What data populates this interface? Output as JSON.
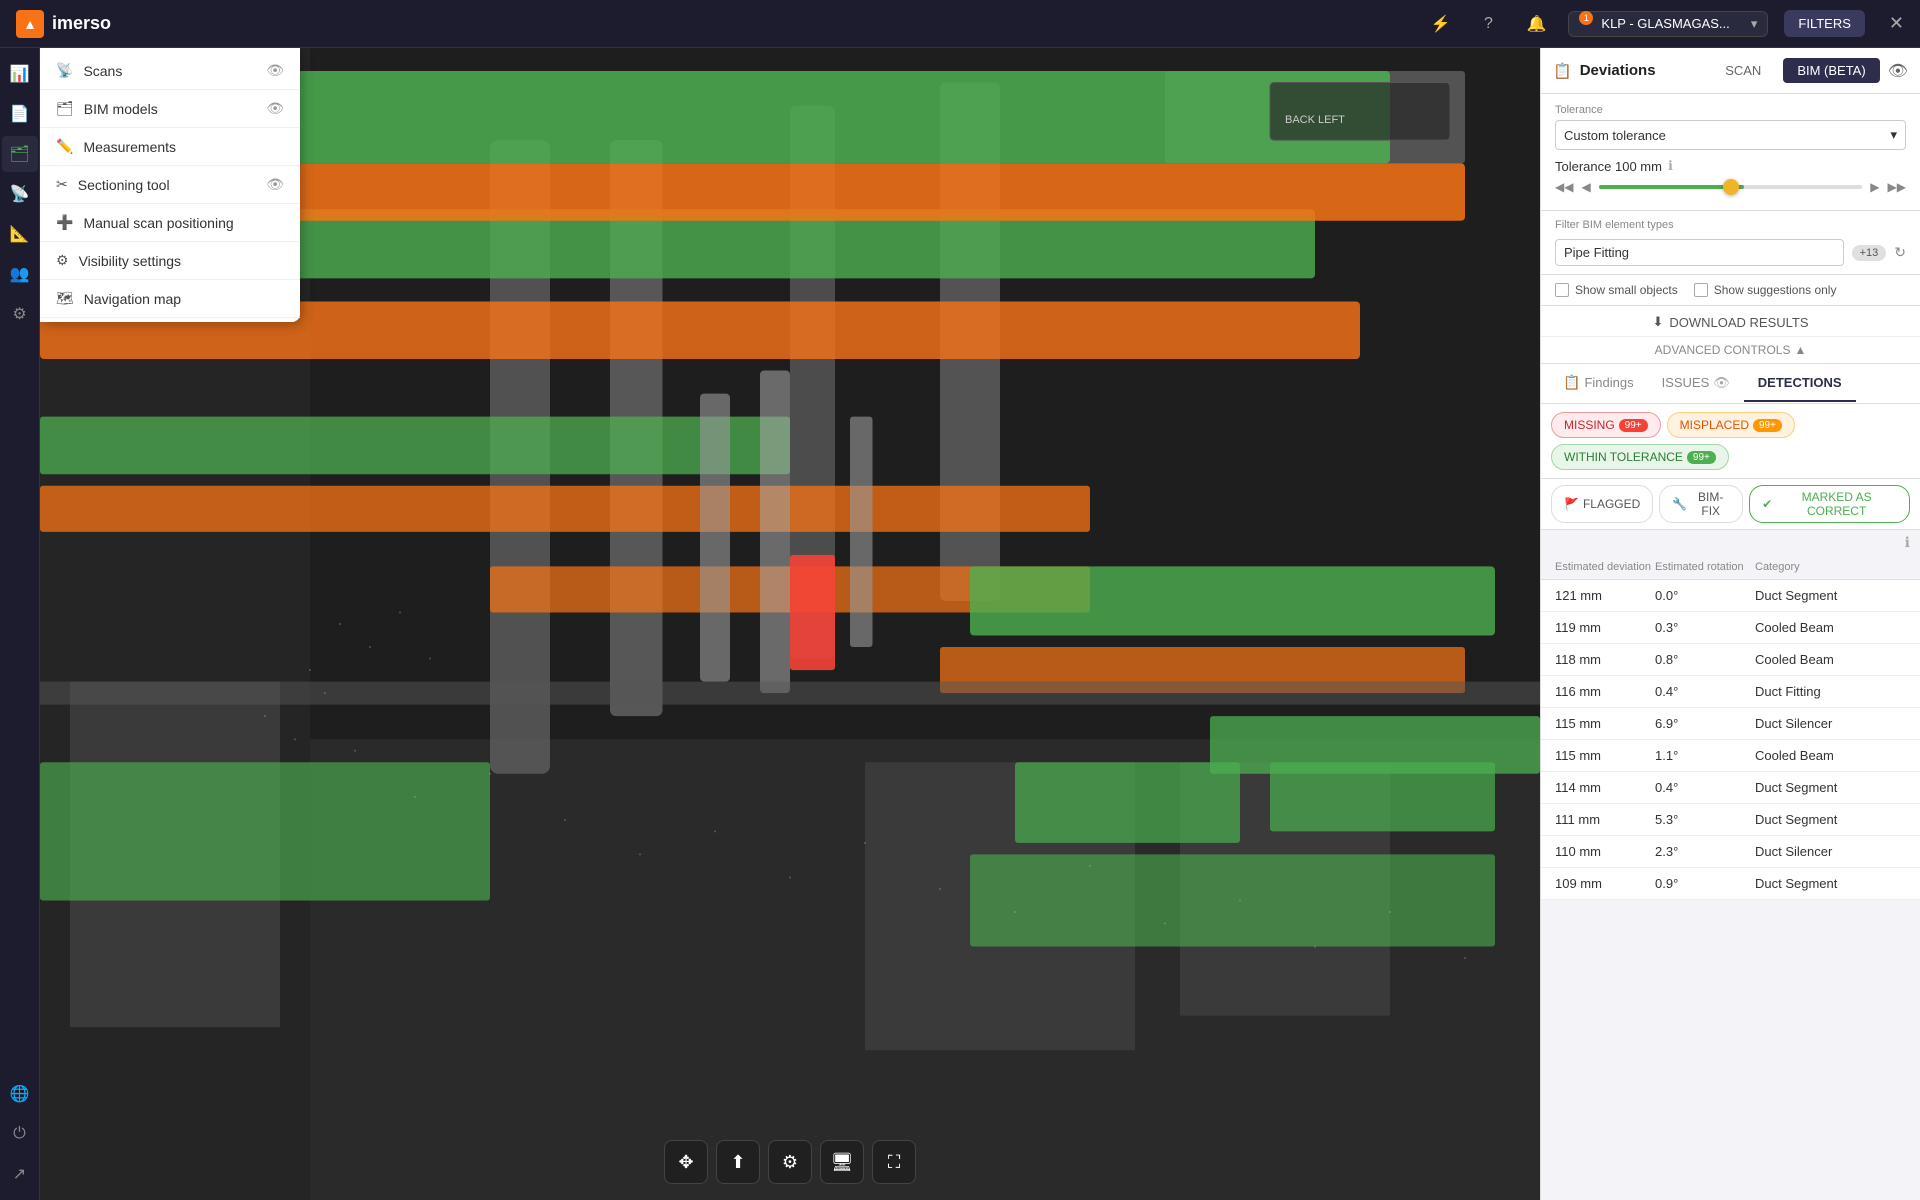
{
  "topbar": {
    "logo_text": "imerso",
    "project_name": "KLP - GLASMAGAS...",
    "filters_label": "FILTERS",
    "notif_count": "1",
    "icons": {
      "bolt": "⚡",
      "help": "?",
      "notif": "🔔"
    }
  },
  "left_menu": {
    "icons": [
      "📊",
      "📄",
      "🗂",
      "📡",
      "📐",
      "👥",
      "⚙",
      "🌐",
      "⚡"
    ]
  },
  "menu_panel": {
    "items": [
      {
        "label": "Scans",
        "icon": "📡",
        "has_eye": true,
        "pen": false
      },
      {
        "label": "BIM models",
        "icon": "🗂",
        "has_eye": true,
        "pen": false
      },
      {
        "label": "Measurements",
        "icon": "✏️",
        "has_eye": false,
        "pen": true
      },
      {
        "label": "Sectioning tool",
        "icon": "✂",
        "has_eye": true,
        "pen": false
      },
      {
        "label": "Manual scan positioning",
        "icon": "➕",
        "has_eye": false,
        "pen": false
      },
      {
        "label": "Visibility settings",
        "icon": "⚙",
        "has_eye": false,
        "pen": false
      },
      {
        "label": "Navigation map",
        "icon": "🗺",
        "has_eye": false,
        "pen": false
      }
    ]
  },
  "right_panel": {
    "deviations_title": "Deviations",
    "tab_scan": "SCAN",
    "tab_bim": "BIM (BETA)",
    "tolerance_section": {
      "label": "Tolerance",
      "custom_tolerance": "Custom tolerance",
      "tolerance_mm_label": "Tolerance 100 mm",
      "slider_min": "◀◀",
      "slider_prev": "◀",
      "slider_next": "▶",
      "slider_max": "▶▶"
    },
    "filter_bim": {
      "label": "Filter BIM element types",
      "selected": "Pipe Fitting",
      "badge": "+13"
    },
    "show_small": "Show small objects",
    "show_suggestions": "Show suggestions only",
    "download_label": "DOWNLOAD RESULTS",
    "advanced_controls": "ADVANCED CONTROLS",
    "findings": {
      "tab_findings": "Findings",
      "tab_issues": "ISSUES",
      "tab_detections": "DETECTIONS",
      "missing_label": "MISSING",
      "missing_count": "99+",
      "misplaced_label": "MISPLACED",
      "misplaced_count": "99+",
      "within_label": "WITHIN TOLERANCE",
      "within_count": "99+",
      "flagged_label": "FLAGGED",
      "bimfix_label": "BIM-FIX",
      "marked_label": "MARKED AS CORRECT",
      "col_deviation": "Estimated deviation",
      "col_rotation": "Estimated rotation",
      "col_category": "Category",
      "rows": [
        {
          "deviation": "121 mm",
          "rotation": "0.0°",
          "category": "Duct Segment"
        },
        {
          "deviation": "119 mm",
          "rotation": "0.3°",
          "category": "Cooled Beam"
        },
        {
          "deviation": "118 mm",
          "rotation": "0.8°",
          "category": "Cooled Beam"
        },
        {
          "deviation": "116 mm",
          "rotation": "0.4°",
          "category": "Duct Fitting"
        },
        {
          "deviation": "115 mm",
          "rotation": "6.9°",
          "category": "Duct Silencer"
        },
        {
          "deviation": "115 mm",
          "rotation": "1.1°",
          "category": "Cooled Beam"
        },
        {
          "deviation": "114 mm",
          "rotation": "0.4°",
          "category": "Duct Segment"
        },
        {
          "deviation": "111 mm",
          "rotation": "5.3°",
          "category": "Duct Segment"
        },
        {
          "deviation": "110 mm",
          "rotation": "2.3°",
          "category": "Duct Silencer"
        },
        {
          "deviation": "109 mm",
          "rotation": "0.9°",
          "category": "Duct Segment"
        }
      ]
    }
  },
  "viewport": {
    "back_label": "BACK",
    "left_label": "LEFT"
  },
  "toolbar_bottom": {
    "icons": [
      "✥",
      "⬆",
      "⚙",
      "🖥",
      "⛶"
    ]
  }
}
